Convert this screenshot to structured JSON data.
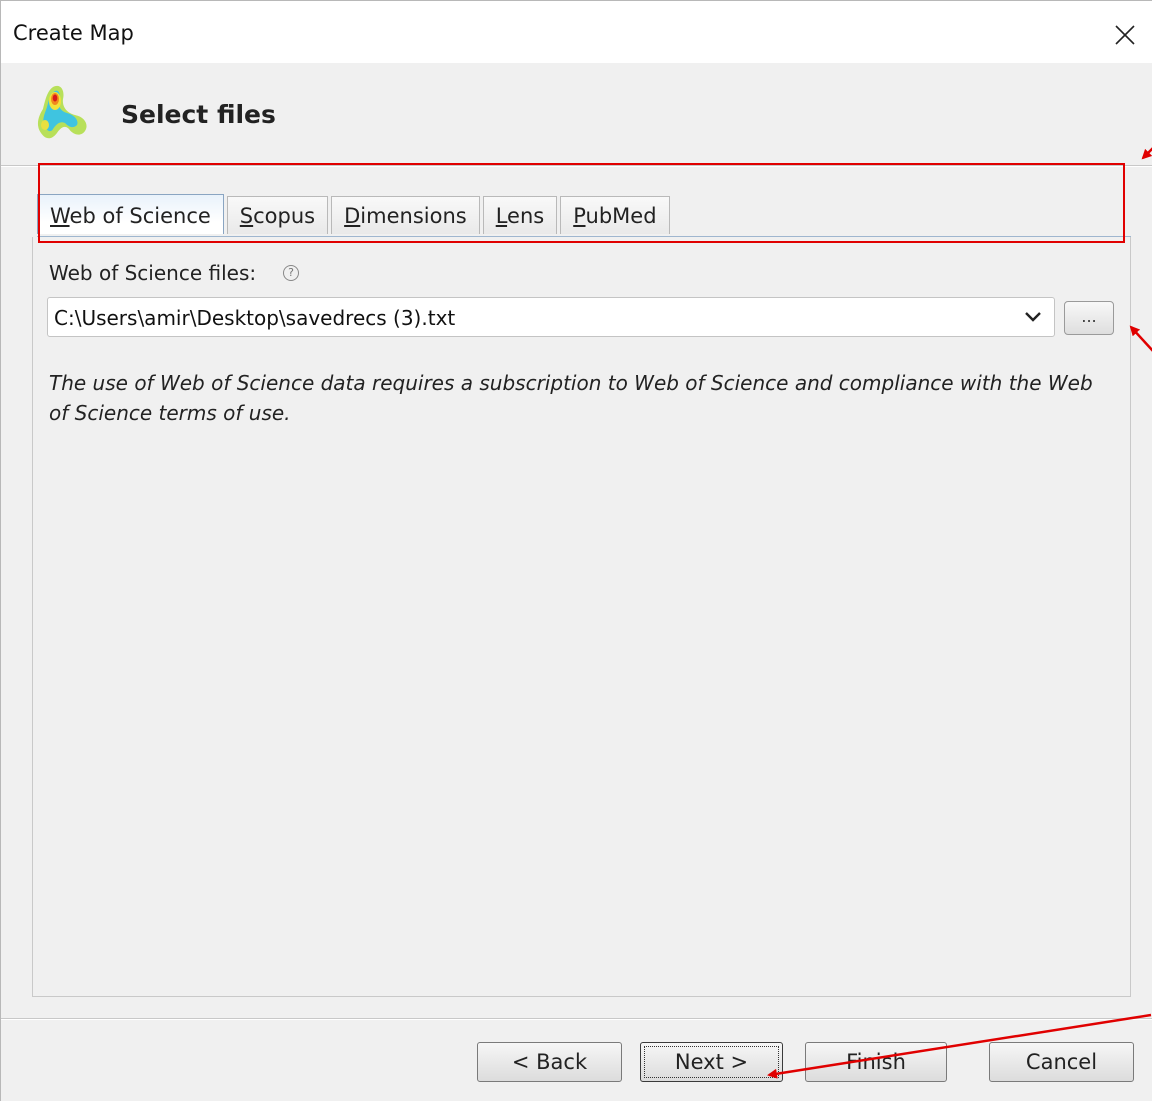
{
  "window": {
    "title": "Create Map",
    "header_title": "Select files"
  },
  "tabs": [
    {
      "label": "Web of Science",
      "mnemonic": "W",
      "rest": "eb of Science",
      "active": true
    },
    {
      "label": "Scopus",
      "mnemonic": "S",
      "rest": "copus",
      "active": false
    },
    {
      "label": "Dimensions",
      "mnemonic": "D",
      "rest": "imensions",
      "active": false
    },
    {
      "label": "Lens",
      "mnemonic": "L",
      "rest": "ens",
      "active": false
    },
    {
      "label": "PubMed",
      "mnemonic": "P",
      "rest": "ubMed",
      "active": false
    }
  ],
  "form": {
    "files_label": "Web of Science files:",
    "help_glyph": "?",
    "file_path": "C:\\Users\\amir\\Desktop\\savedrecs (3).txt",
    "browse_label": "...",
    "notice": "The use of Web of Science data requires a subscription to Web of Science and compliance with the Web of Science terms of use."
  },
  "footer": {
    "back_label": "< Back",
    "next_label": "Next >",
    "finish_label": "Finish",
    "cancel_label": "Cancel"
  },
  "colors": {
    "annotation": "#e00000",
    "active_tab": "#e9f2fb"
  }
}
